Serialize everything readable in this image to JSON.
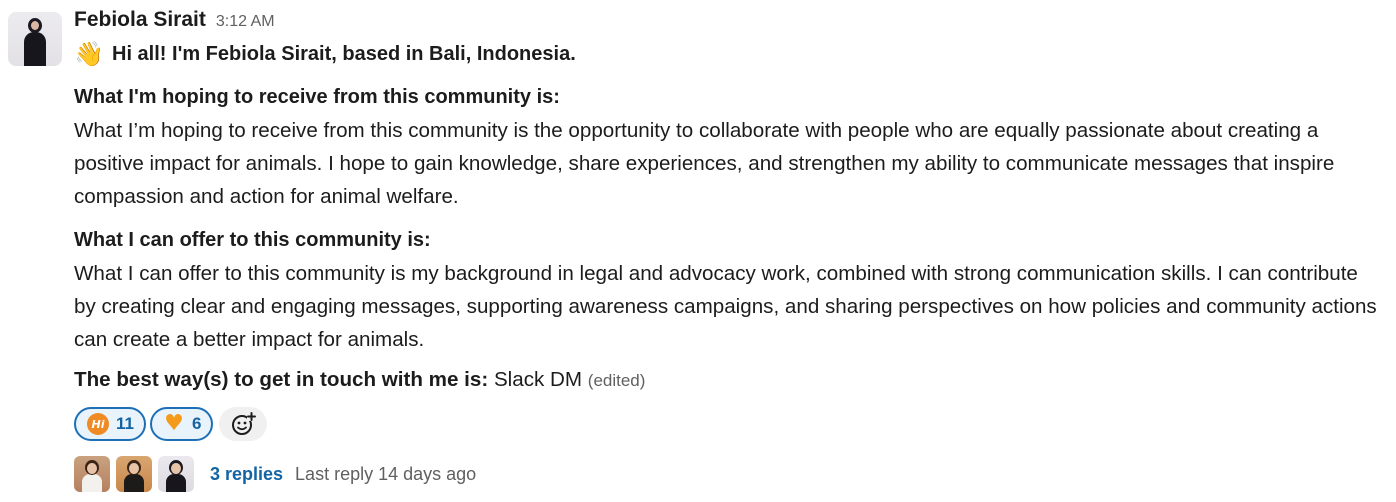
{
  "message": {
    "sender": "Febiola Sirait",
    "timestamp": "3:12 AM",
    "intro_emoji": "waving-hand",
    "intro_text": "Hi all! I'm Febiola Sirait, based in Bali, Indonesia.",
    "sections": [
      {
        "heading": "What I'm hoping to receive from this community is:",
        "body": "What I’m hoping to receive from this community is the opportunity to collaborate with people who are equally passionate about creating a positive impact for animals. I hope to gain knowledge, share experiences, and strengthen my ability to communicate messages that inspire compassion and action for animal welfare."
      },
      {
        "heading": "What I can offer to this community is:",
        "body": "What I can offer to this community is my background in legal and advocacy work, combined with strong communication skills. I can contribute by creating clear and engaging messages, supporting awareness campaigns, and sharing perspectives on how policies and community actions can create a better impact for animals."
      }
    ],
    "contact_label": "The best way(s) to get in touch with me is:",
    "contact_value": "Slack DM",
    "edited_label": "(edited)"
  },
  "reactions": [
    {
      "icon": "hi-bubble-icon",
      "count": "11"
    },
    {
      "icon": "orange-heart-icon",
      "count": "6"
    }
  ],
  "add_reaction_icon": "add-reaction-icon",
  "thread": {
    "replies_label": "3 replies",
    "last_reply_label": "Last reply 14 days ago"
  },
  "colors": {
    "link": "#1264a3",
    "reaction_border": "#1d6fb8",
    "reaction_bg": "#e8f3fb",
    "muted_text": "#616061"
  }
}
